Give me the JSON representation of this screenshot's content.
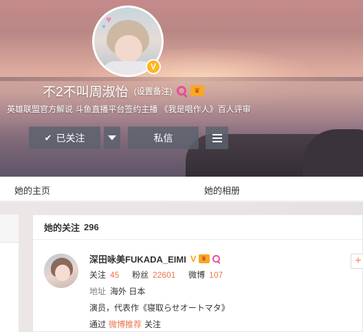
{
  "profile": {
    "name": "不2不叫周淑怡",
    "remark": "(设置备注)",
    "bio": "英雄联盟官方解说 斗鱼直播平台签约主播 《我是唱作人》百人评审",
    "verified_badge": "V"
  },
  "actions": {
    "follow_label": "已关注",
    "message_label": "私信"
  },
  "tabs": [
    {
      "label": "她的主页"
    },
    {
      "label": "她的相册"
    }
  ],
  "following_panel": {
    "title": "她的关注",
    "count": "296",
    "user": {
      "name": "深田咏美FUKADA_EIMI",
      "follow_label": "关注",
      "follow_count": "45",
      "fans_label": "粉丝",
      "fans_count": "22601",
      "weibo_label": "微博",
      "weibo_count": "107",
      "location_label": "地址",
      "location": "海外 日本",
      "description": "演员，代表作《寝取らせオートマタ》",
      "via_prefix": "通过",
      "via_link": "微博推荐",
      "via_suffix": "关注",
      "add_symbol": "+"
    }
  },
  "icons": [
    "heart-icon",
    "verified-v-icon",
    "pink-search-icon",
    "crown-icon",
    "check-icon",
    "caret-down-icon",
    "menu-icon",
    "plus-icon"
  ],
  "colors": {
    "accent_orange": "#eb7350",
    "verified_yellow": "#ffb51f",
    "button_bg": "#5a616e"
  }
}
